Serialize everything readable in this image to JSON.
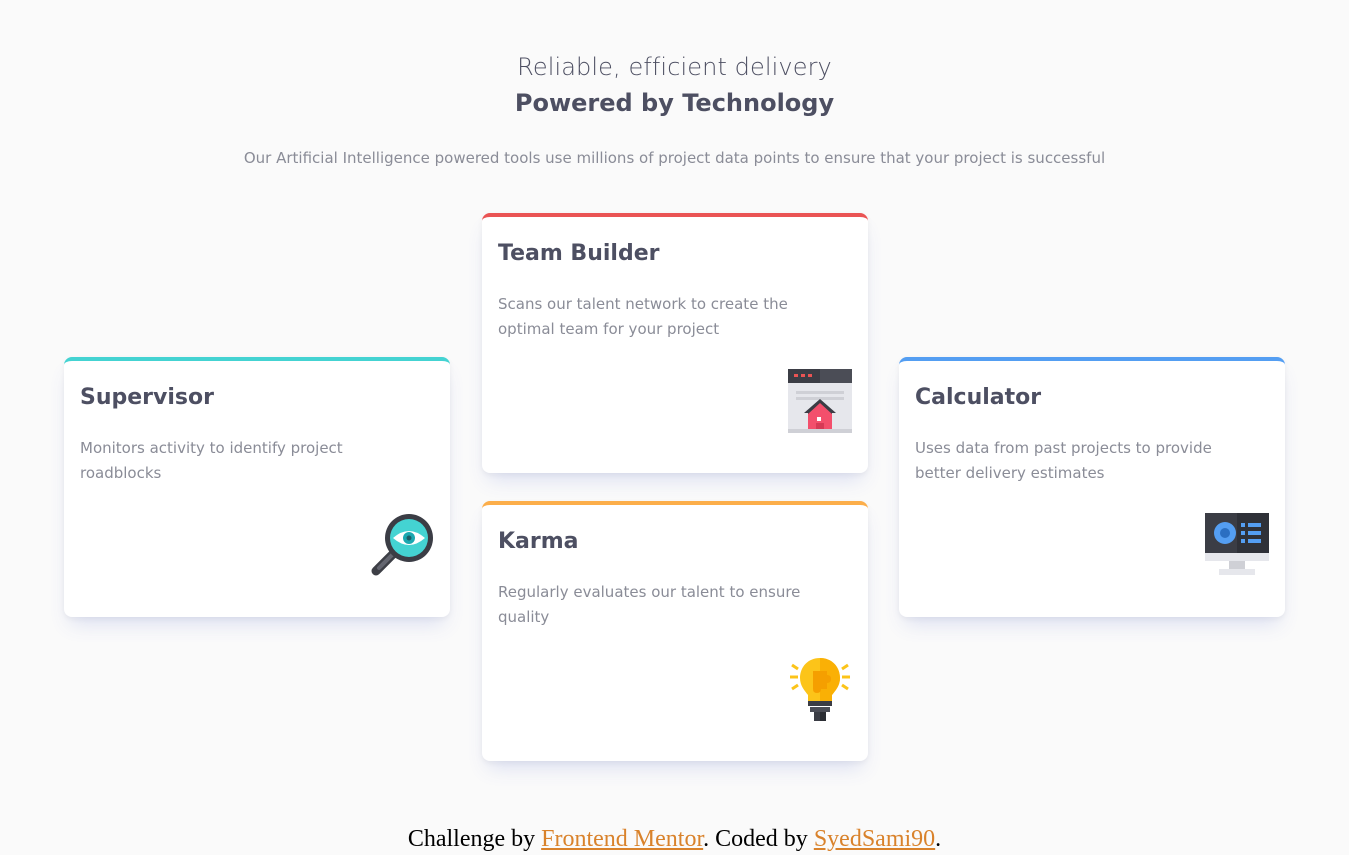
{
  "header": {
    "title_light": "Reliable, efficient delivery",
    "title_bold": "Powered by Technology",
    "subtitle": "Our Artificial Intelligence powered tools use millions of project data points to ensure that your project is successful"
  },
  "cards": [
    {
      "title": "Supervisor",
      "description": "Monitors activity to identify project roadblocks",
      "icon": "magnifier-eye-icon",
      "accent": "#44d3d2"
    },
    {
      "title": "Team Builder",
      "description": "Scans our talent network to create the optimal team for your project",
      "icon": "team-builder-house-icon",
      "accent": "#ea5454"
    },
    {
      "title": "Karma",
      "description": "Regularly evaluates our talent to ensure quality",
      "icon": "lightbulb-icon",
      "accent": "#fcae4a"
    },
    {
      "title": "Calculator",
      "description": "Uses data from past projects to provide better delivery estimates",
      "icon": "monitor-calculator-icon",
      "accent": "#549ef2"
    }
  ],
  "footer": {
    "prefix": "Challenge by ",
    "link1": "Frontend Mentor",
    "middle": ". Coded by ",
    "link2": "SyedSami90",
    "suffix": "."
  },
  "colors": {
    "background": "#fafafa",
    "text_dark": "#4d4f62",
    "text_muted": "#8a8c97",
    "link": "#d9822b"
  }
}
